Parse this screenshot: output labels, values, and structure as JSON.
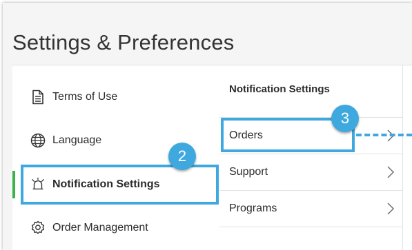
{
  "page": {
    "title": "Settings & Preferences"
  },
  "sidebar": {
    "items": [
      {
        "label": "Terms of Use",
        "icon": "document-icon",
        "active": false
      },
      {
        "label": "Language",
        "icon": "globe-icon",
        "active": false
      },
      {
        "label": "Notification Settings",
        "icon": "alarm-bell-icon",
        "active": true
      },
      {
        "label": "Order Management",
        "icon": "gear-icon",
        "active": false
      }
    ]
  },
  "notifications": {
    "header": "Notification Settings",
    "rows": [
      {
        "label": "Orders"
      },
      {
        "label": "Support"
      },
      {
        "label": "Programs"
      }
    ]
  },
  "annotations": {
    "step2": "2",
    "step3": "3"
  },
  "colors": {
    "accent_green": "#3cb34a",
    "highlight_blue": "#3fa9df",
    "background": "#f5f5f5"
  }
}
